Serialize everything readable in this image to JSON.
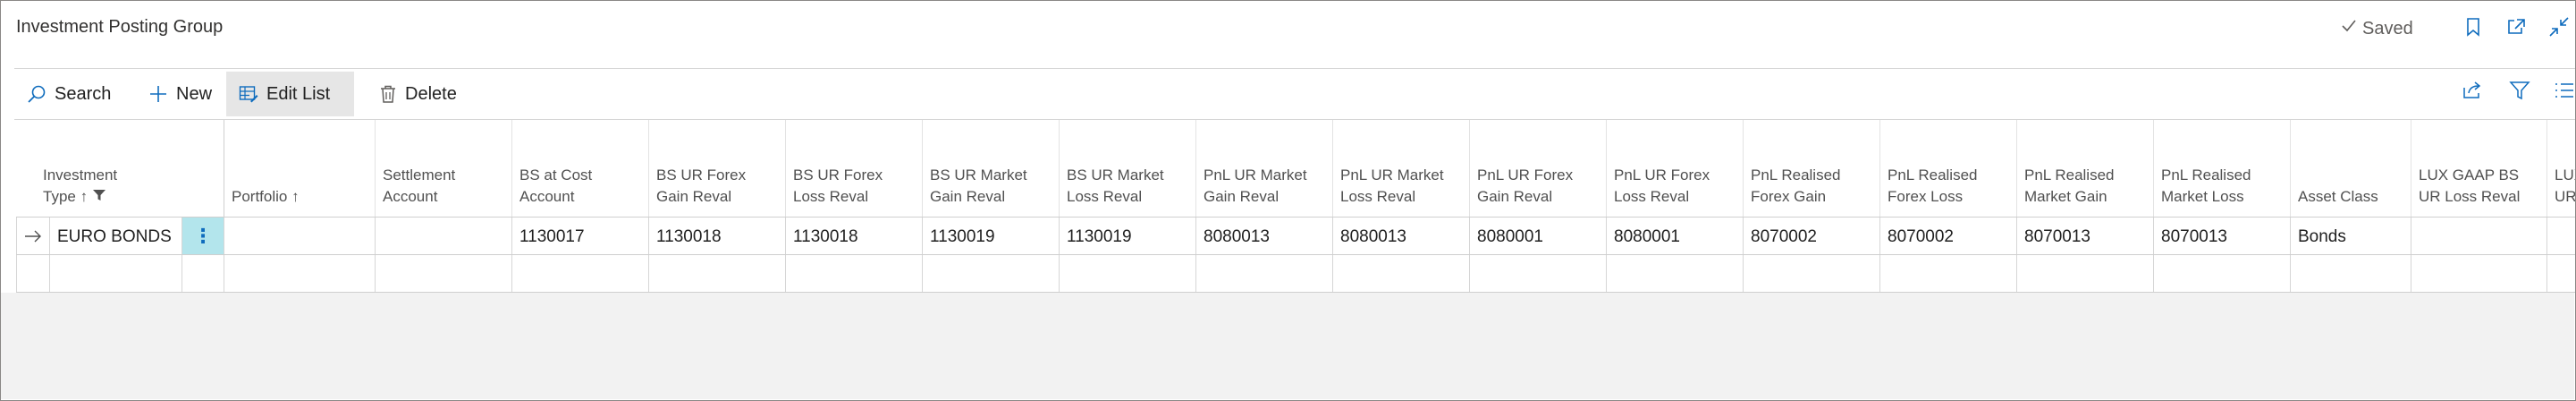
{
  "page": {
    "title": "Investment Posting Group",
    "saved_label": "Saved"
  },
  "title_icons": [
    "bookmark-icon",
    "open-new-window-icon",
    "collapse-icon"
  ],
  "actions": {
    "search": "Search",
    "new": "New",
    "edit_list": "Edit List",
    "delete": "Delete"
  },
  "action_right_icons": [
    "share-icon",
    "filter-icon",
    "list-view-icon"
  ],
  "columns": [
    {
      "label": "Investment\nType ↑"
    },
    {
      "label": "Portfolio ↑"
    },
    {
      "label": "Settlement\nAccount"
    },
    {
      "label": "BS at Cost\nAccount"
    },
    {
      "label": "BS UR Forex\nGain Reval"
    },
    {
      "label": "BS UR Forex\nLoss Reval"
    },
    {
      "label": "BS UR Market\nGain Reval"
    },
    {
      "label": "BS UR Market\nLoss Reval"
    },
    {
      "label": "PnL UR Market\nGain Reval"
    },
    {
      "label": "PnL UR Market\nLoss Reval"
    },
    {
      "label": "PnL UR Forex\nGain Reval"
    },
    {
      "label": "PnL UR Forex\nLoss Reval"
    },
    {
      "label": "PnL Realised\nForex Gain"
    },
    {
      "label": "PnL Realised\nForex Loss"
    },
    {
      "label": "PnL Realised\nMarket Gain"
    },
    {
      "label": "PnL Realised\nMarket Loss"
    },
    {
      "label": "Asset Class"
    },
    {
      "label": "LUX GAAP BS\nUR Loss Reval"
    },
    {
      "label": "LUX G\nUR Lo"
    }
  ],
  "rows": [
    {
      "cells": [
        "EURO BONDS",
        "",
        "",
        "1130017",
        "1130018",
        "1130018",
        "1130019",
        "1130019",
        "8080013",
        "8080013",
        "8080001",
        "8080001",
        "8070002",
        "8070002",
        "8070013",
        "8070013",
        "Bonds",
        "",
        ""
      ]
    },
    {
      "cells": [
        "",
        "",
        "",
        "",
        "",
        "",
        "",
        "",
        "",
        "",
        "",
        "",
        "",
        "",
        "",
        "",
        "",
        "",
        ""
      ]
    }
  ],
  "colors": {
    "accent": "#0f6cbd",
    "selected_cell": "#b3e5ec",
    "active_action": "#e6e6e6",
    "empty_area": "#f2f2f2"
  }
}
